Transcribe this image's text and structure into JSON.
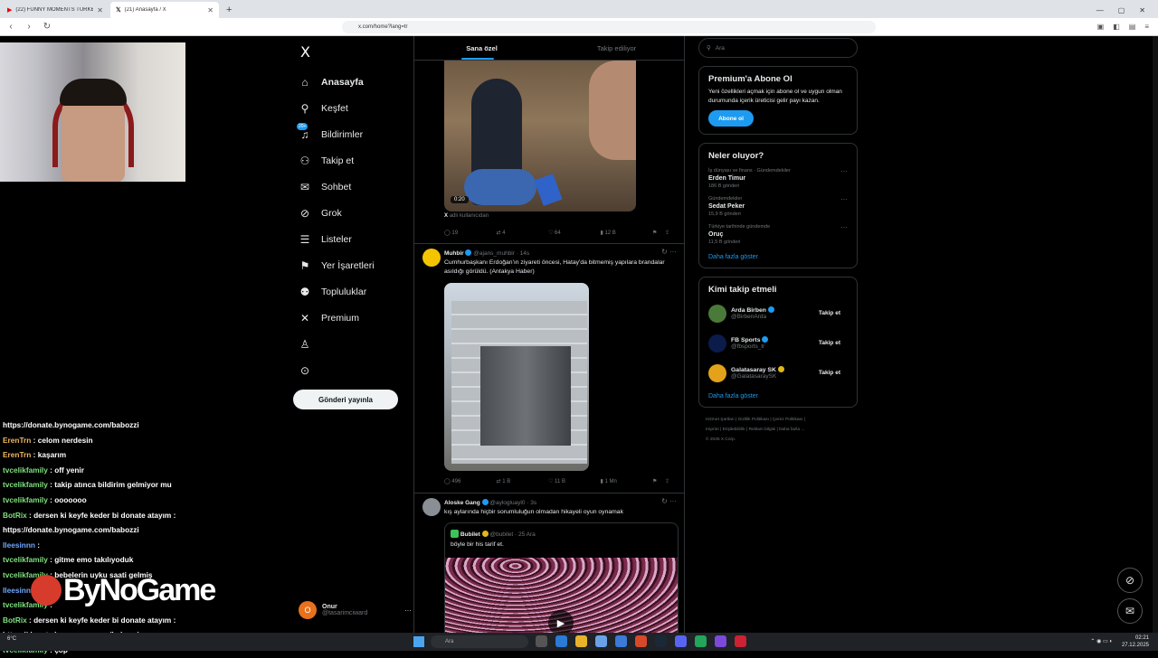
{
  "browser": {
    "tabs": [
      {
        "title": "(22) FUNNY MOMENTS TÜRKEY - Yo",
        "icon": "youtube-icon"
      },
      {
        "title": "(21) Anasayfa / X",
        "icon": "x-icon"
      }
    ],
    "url": "x.com/home?lang=tr"
  },
  "x_nav": {
    "logo": "X",
    "items": [
      {
        "label": "Anasayfa",
        "icon": "home-icon"
      },
      {
        "label": "Keşfet",
        "icon": "search-icon"
      },
      {
        "label": "Bildirimler",
        "icon": "bell-icon",
        "badge": "20+"
      },
      {
        "label": "Takip et",
        "icon": "person-add-icon"
      },
      {
        "label": "Sohbet",
        "icon": "mail-icon"
      },
      {
        "label": "Grok",
        "icon": "grok-icon"
      },
      {
        "label": "Listeler",
        "icon": "list-icon"
      },
      {
        "label": "Yer İşaretleri",
        "icon": "bookmark-icon"
      },
      {
        "label": "Topluluklar",
        "icon": "people-icon"
      },
      {
        "label": "Premium",
        "icon": "x-icon"
      },
      {
        "label": "",
        "icon": "profile-icon"
      },
      {
        "label": "",
        "icon": "more-icon"
      }
    ],
    "post_button": "Gönderi yayınla",
    "account": {
      "name": "Onur",
      "handle": "@tasarimciward",
      "initial": "O"
    }
  },
  "timeline": {
    "tabs": [
      "Sana özel",
      "Takip ediliyor"
    ],
    "tweet1": {
      "duration": "0:20",
      "attribution_prefix": "X",
      "attribution": "adlı kullanıcıdan",
      "replies": "19",
      "retweets": "4",
      "likes": "64",
      "views": "12 B"
    },
    "tweet2": {
      "name": "Muhbir",
      "handle": "@ajans_muhbir · 14s",
      "text": "Cumhurbaşkanı Erdoğan'ın ziyareti öncesi, Hatay'da bitmemiş yapılara brandalar asıldığı görüldü. (Antakya Haber)",
      "replies": "496",
      "retweets": "1 B",
      "likes": "11 B",
      "views": "1 Mn"
    },
    "tweet3": {
      "name": "Aloske Gang",
      "handle": "@aylogluayl0 · 3s",
      "text": "kış aylarında hiçbir sorumluluğun olmadan hikayeli oyun oynamak",
      "quote": {
        "name": "Bubilet",
        "handle": "@bubilet · 25 Ara",
        "text": "böyle bir his tarif et."
      }
    }
  },
  "right": {
    "search_placeholder": "Ara",
    "premium": {
      "title": "Premium'a Abone Ol",
      "text": "Yeni özellikleri açmak için abone ol ve uygun olman durumunda içerik üreticisi gelir payı kazan.",
      "button": "Abone ol"
    },
    "trends": {
      "title": "Neler oluyor?",
      "items": [
        {
          "context": "İş dünyası ve finans · Gündemdekiler",
          "topic": "Erden Timur",
          "posts": "186 B gönderi"
        },
        {
          "context": "Gündemdekiler",
          "topic": "Sedat Peker",
          "posts": "15,9 B gönderi"
        },
        {
          "context": "Türkiye tarihinde gündemde",
          "topic": "Oruç",
          "posts": "11,5 B gönderi"
        }
      ],
      "show_more": "Daha fazla göster"
    },
    "who_to_follow": {
      "title": "Kimi takip etmeli",
      "items": [
        {
          "name": "Arda Birben",
          "handle": "@BirbenArda",
          "button": "Takip et",
          "color": "#4a7a3a"
        },
        {
          "name": "FB Sports",
          "handle": "@fbsports_tr",
          "button": "Takip et",
          "color": "#0b1c4b"
        },
        {
          "name": "Galatasaray SK",
          "handle": "@GalatasaraySK",
          "button": "Takip et",
          "color": "#e3a21a"
        }
      ],
      "show_more": "Daha fazla göster"
    },
    "footer": [
      "Hizmet Şartları",
      "Gizlilik Politikası",
      "Çerez Politikası",
      "Imprint",
      "Erişilebilirlik",
      "Reklam bilgisi",
      "Daha fazla ...",
      "© 2025 X Corp."
    ]
  },
  "chat": [
    {
      "user": "",
      "msg": "https://donate.bynogame.com/babozzi",
      "color": "#ffffff"
    },
    {
      "user": "ErenTrn",
      "msg": "celom nerdesin",
      "color": "#f0b866"
    },
    {
      "user": "ErenTrn",
      "msg": "kaşarım",
      "color": "#f0b866"
    },
    {
      "user": "tvcelikfamily",
      "msg": "off yenir",
      "color": "#7ee07e"
    },
    {
      "user": "tvcelikfamily",
      "msg": "takip atınca bildirim gelmiyor mu",
      "color": "#7ee07e"
    },
    {
      "user": "tvcelikfamily",
      "msg": "ooooooo",
      "color": "#7ee07e"
    },
    {
      "user": "BotRix",
      "msg": "dersen ki keyfe keder bi donate atayım :",
      "color": "#7ee07e"
    },
    {
      "user": "",
      "msg": "https://donate.bynogame.com/babozzi",
      "color": "#ffffff"
    },
    {
      "user": "lleesinnn",
      "msg": "",
      "color": "#6fa8ff"
    },
    {
      "user": "tvcelikfamily",
      "msg": "gitme emo takılıyoduk",
      "color": "#7ee07e"
    },
    {
      "user": "tvcelikfamily",
      "msg": "bebelerin uyku saati gelmiş",
      "color": "#7ee07e"
    },
    {
      "user": "lleesinnn",
      "msg": "...nel",
      "color": "#6fa8ff"
    },
    {
      "user": "tvcelikfamily",
      "msg": "",
      "color": "#7ee07e"
    },
    {
      "user": "BotRix",
      "msg": "dersen ki keyfe keder bi donate atayım :",
      "color": "#7ee07e"
    },
    {
      "user": "",
      "msg": "https://donate.bynogame.com/babozzi",
      "color": "#ffffff"
    },
    {
      "user": "tvcelikfamily",
      "msg": "çöp",
      "color": "#7ee07e"
    }
  ],
  "overlay": {
    "logo": "ByNoGame"
  },
  "taskbar": {
    "search_placeholder": "Ara",
    "time": "02:21",
    "date": "27.12.2025",
    "weather": "6°C"
  }
}
